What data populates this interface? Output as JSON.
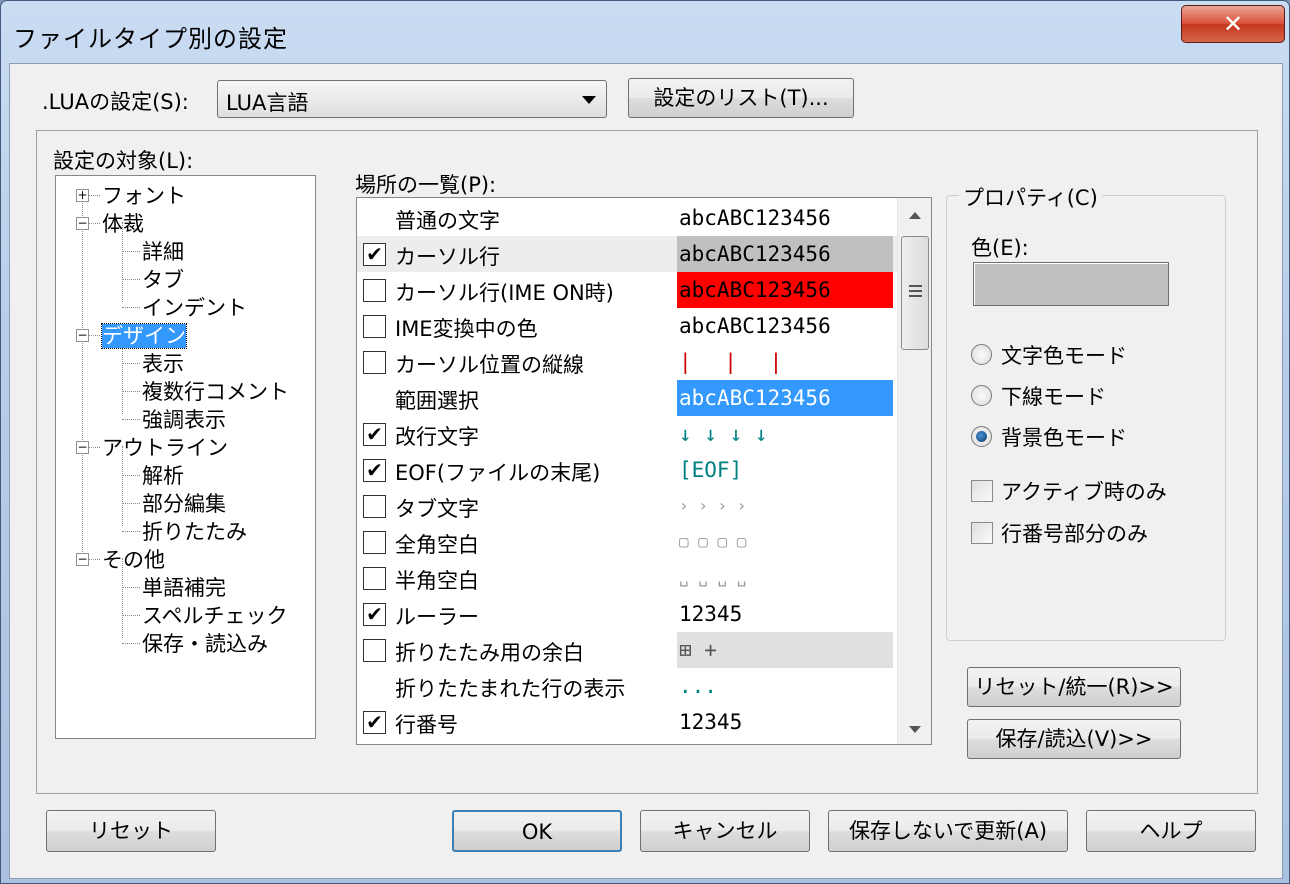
{
  "window": {
    "title": "ファイルタイプ別の設定",
    "close_label": "✕"
  },
  "filetype": {
    "label": ".LUAの設定(S):",
    "selected": "LUA言語",
    "list_button": "設定のリスト(T)..."
  },
  "target": {
    "label": "設定の対象(L):",
    "tree": [
      {
        "label": "フォント",
        "expander": "+"
      },
      {
        "label": "体裁",
        "expander": "−"
      },
      {
        "label": "詳細"
      },
      {
        "label": "タブ"
      },
      {
        "label": "インデント"
      },
      {
        "label": "デザイン",
        "expander": "−",
        "selected": true
      },
      {
        "label": "表示"
      },
      {
        "label": "複数行コメント"
      },
      {
        "label": "強調表示"
      },
      {
        "label": "アウトライン",
        "expander": "−"
      },
      {
        "label": "解析"
      },
      {
        "label": "部分編集"
      },
      {
        "label": "折りたたみ"
      },
      {
        "label": "その他",
        "expander": "−"
      },
      {
        "label": "単語補完"
      },
      {
        "label": "スペルチェック"
      },
      {
        "label": "保存・読込み"
      }
    ]
  },
  "places": {
    "label": "場所の一覧(P):",
    "rows": [
      {
        "name": "普通の文字",
        "checkbox": null,
        "sample": "abcABC123456"
      },
      {
        "name": "カーソル行",
        "checkbox": true,
        "sample": "abcABC123456"
      },
      {
        "name": "カーソル行(IME ON時)",
        "checkbox": false,
        "sample": "abcABC123456"
      },
      {
        "name": "IME変換中の色",
        "checkbox": false,
        "sample": "abcABC123456"
      },
      {
        "name": "カーソル位置の縦線",
        "checkbox": false,
        "sample": "| | |"
      },
      {
        "name": "範囲選択",
        "checkbox": null,
        "sample": "abcABC123456"
      },
      {
        "name": "改行文字",
        "checkbox": true,
        "sample": "↓  ↓  ↓  ↓"
      },
      {
        "name": "EOF(ファイルの末尾)",
        "checkbox": true,
        "sample": "[EOF]"
      },
      {
        "name": "タブ文字",
        "checkbox": false,
        "sample": "›    ›    ›    ›"
      },
      {
        "name": "全角空白",
        "checkbox": false,
        "sample": "▢  ▢  ▢  ▢"
      },
      {
        "name": "半角空白",
        "checkbox": false,
        "sample": "␣  ␣  ␣  ␣"
      },
      {
        "name": "ルーラー",
        "checkbox": true,
        "sample": "12345"
      },
      {
        "name": "折りたたみ用の余白",
        "checkbox": false,
        "sample": "⊞ +"
      },
      {
        "name": "折りたたまれた行の表示",
        "checkbox": null,
        "sample": "..."
      },
      {
        "name": "行番号",
        "checkbox": true,
        "sample": "12345"
      }
    ]
  },
  "properties": {
    "group_label": "プロパティ(C)",
    "color_label": "色(E):",
    "swatch_color": "#c0c0c0",
    "modes": [
      {
        "label": "文字色モード",
        "selected": false
      },
      {
        "label": "下線モード",
        "selected": false
      },
      {
        "label": "背景色モード",
        "selected": true
      }
    ],
    "checks": [
      {
        "label": "アクティブ時のみ",
        "checked": false
      },
      {
        "label": "行番号部分のみ",
        "checked": false
      }
    ]
  },
  "side_buttons": {
    "reset_unify": "リセット/統一(R)>>",
    "save_load": "保存/読込(V)>>"
  },
  "footer": {
    "reset": "リセット",
    "ok": "OK",
    "cancel": "キャンセル",
    "update_no_save": "保存しないで更新(A)",
    "help": "ヘルプ"
  },
  "colors": {
    "cursor_line_bg": "#c0c0c0",
    "ime_line_bg": "#ff0000",
    "selection_bg": "#3399ff",
    "vline_color": "#cc0000",
    "symbol_color": "#008080"
  }
}
